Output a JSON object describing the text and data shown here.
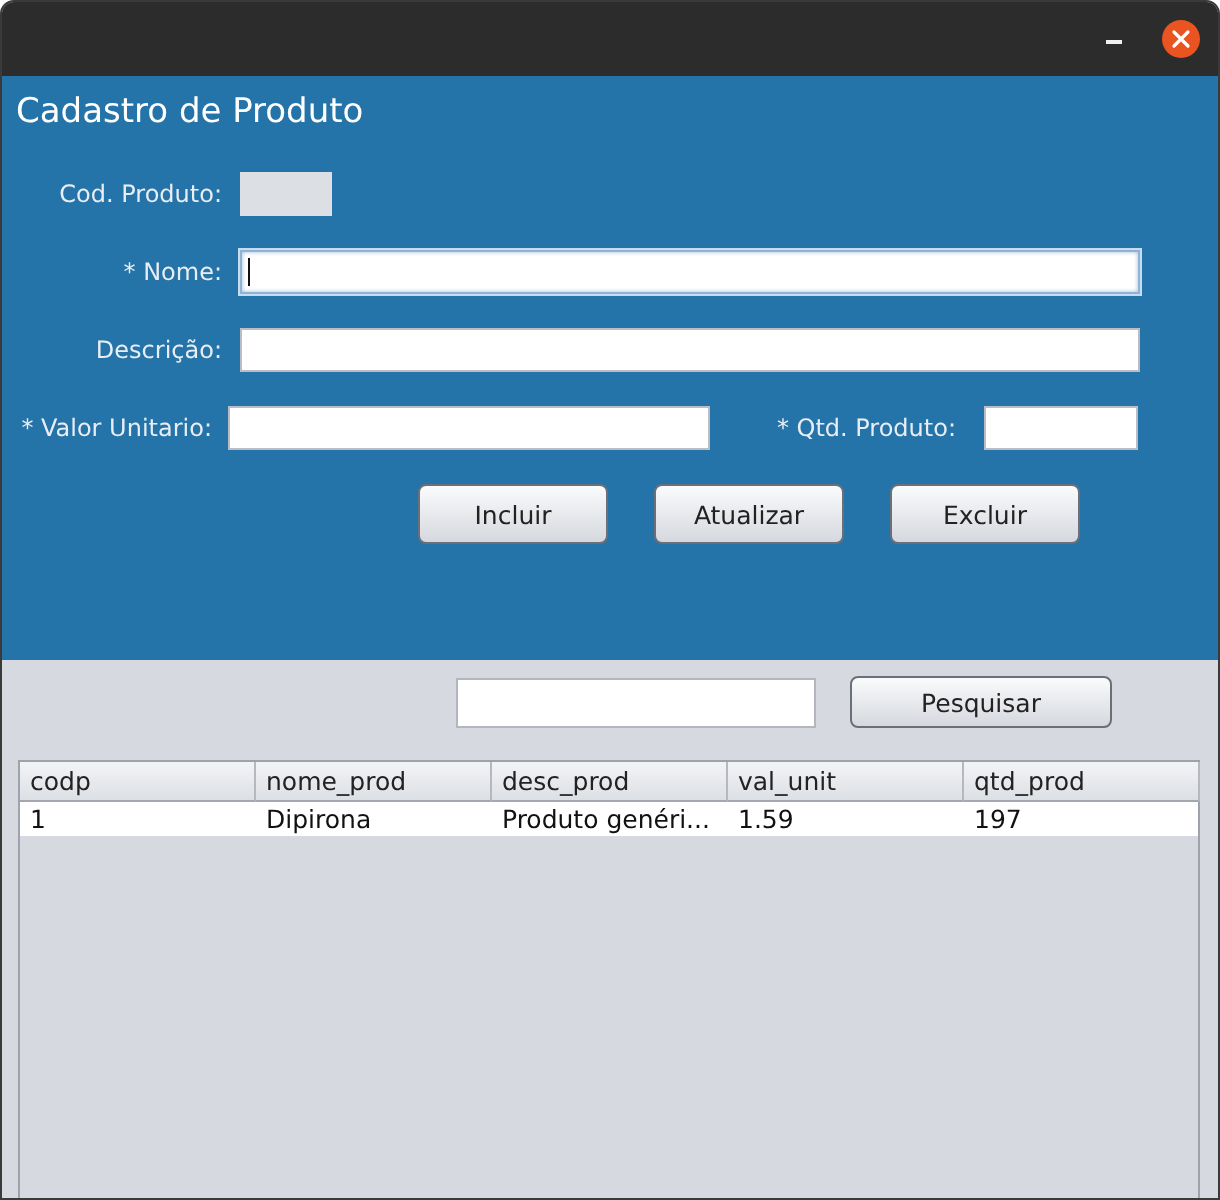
{
  "form": {
    "title": "Cadastro de Produto",
    "rows": [
      [
        {
          "label": "Cod. Produto:",
          "disabled": true,
          "focused": false
        }
      ],
      [
        {
          "label": "* Nome:",
          "disabled": false,
          "focused": true
        }
      ],
      [
        {
          "label": "Descrição:",
          "disabled": false,
          "focused": false
        }
      ],
      [
        {
          "label": "* Valor Unitario:",
          "disabled": false,
          "focused": false
        },
        {
          "label": "* Qtd. Produto:",
          "disabled": false,
          "focused": false
        }
      ]
    ],
    "buttons": [
      "Incluir",
      "Atualizar",
      "Excluir"
    ]
  },
  "search": {
    "button": "Pesquisar"
  },
  "table": {
    "columns": [
      "codp",
      "nome_prod",
      "desc_prod",
      "val_unit",
      "qtd_prod"
    ],
    "rows": [
      {
        "cells": [
          "1",
          "Dipirona",
          "Produto genéri...",
          "1.59",
          "197"
        ],
        "selected": false
      }
    ]
  }
}
